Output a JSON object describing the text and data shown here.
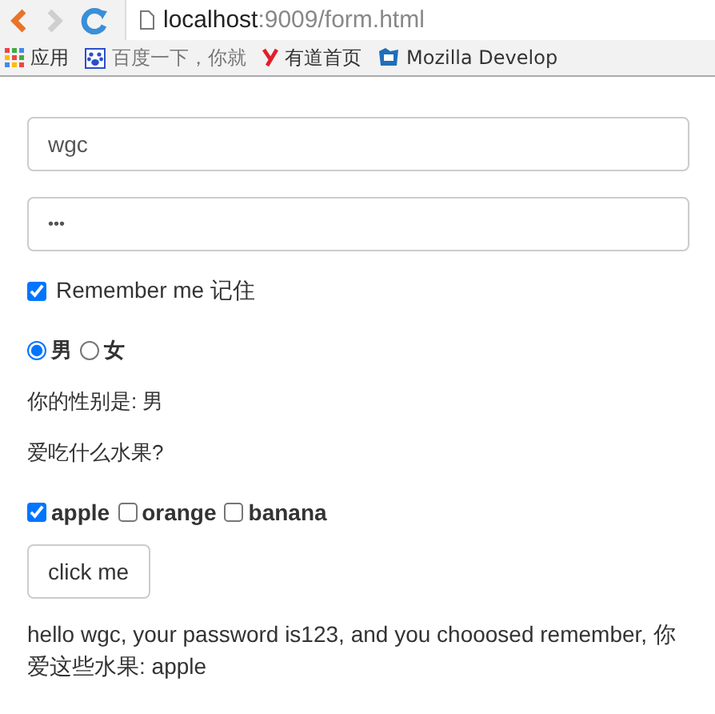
{
  "browser": {
    "url_host": "localhost",
    "url_path": ":9009/form.html"
  },
  "bookmarks": [
    {
      "kind": "apps",
      "label": "应用"
    },
    {
      "kind": "paw",
      "label": "百度一下，你就"
    },
    {
      "kind": "y",
      "label": "有道首页"
    },
    {
      "kind": "mdn",
      "label": "Mozilla Develop"
    }
  ],
  "form": {
    "username": "wgc",
    "password": "•••",
    "remember": {
      "label": "Remember me 记住",
      "checked": true
    },
    "genders": [
      {
        "label": "男",
        "selected": true
      },
      {
        "label": "女",
        "selected": false
      }
    ],
    "gender_text": "你的性别是: 男",
    "fruit_question": "爱吃什么水果?",
    "fruits": [
      {
        "label": "apple",
        "checked": true
      },
      {
        "label": "orange",
        "checked": false
      },
      {
        "label": "banana",
        "checked": false
      }
    ],
    "button": "click me",
    "result": "hello wgc, your password is123, and you chooosed remember, 你爱这些水果: apple"
  }
}
